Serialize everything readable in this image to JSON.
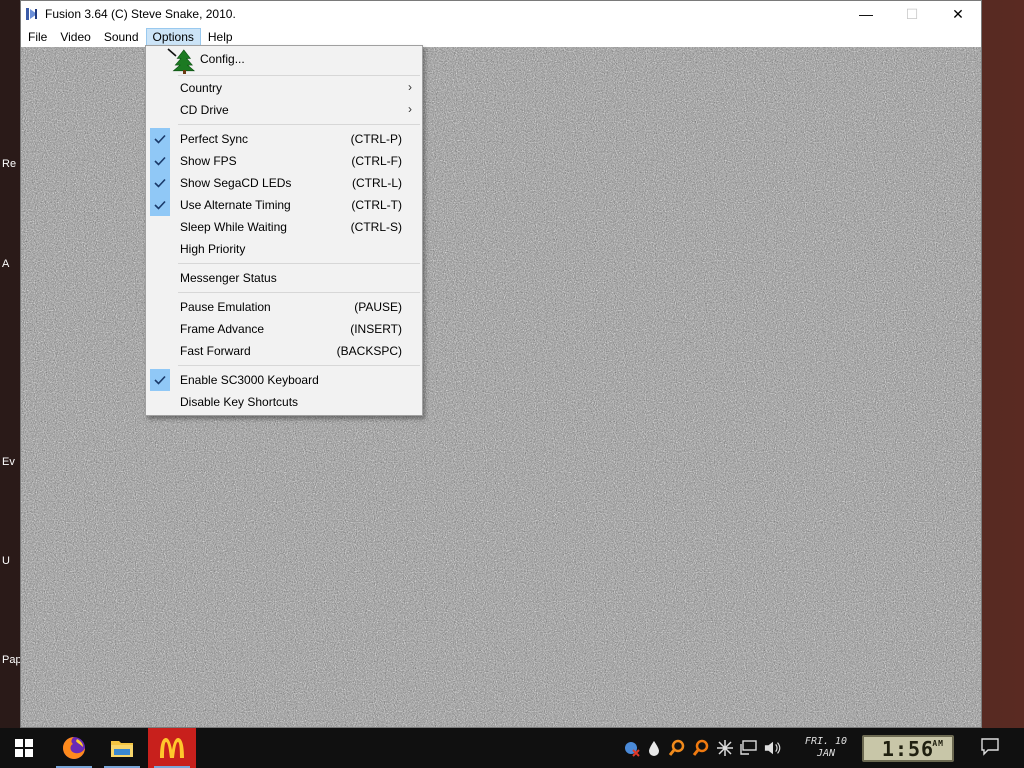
{
  "window": {
    "title": "Fusion 3.64 (C) Steve Snake, 2010.",
    "minimize_glyph": "—",
    "maximize_glyph": "☐",
    "close_glyph": "✕"
  },
  "menubar": [
    "File",
    "Video",
    "Sound",
    "Options",
    "Help"
  ],
  "options_menu": {
    "config": "Config...",
    "country": "Country",
    "cd_drive": "CD Drive",
    "perfect_sync": "Perfect Sync",
    "perfect_sync_shortcut": "(CTRL-P)",
    "show_fps": "Show FPS",
    "show_fps_shortcut": "(CTRL-F)",
    "show_segacd_leds": "Show SegaCD LEDs",
    "show_segacd_leds_shortcut": "(CTRL-L)",
    "use_alternate_timing": "Use Alternate Timing",
    "use_alternate_timing_shortcut": "(CTRL-T)",
    "sleep_while_waiting": "Sleep While Waiting",
    "sleep_while_waiting_shortcut": "(CTRL-S)",
    "high_priority": "High Priority",
    "messenger_status": "Messenger Status",
    "pause_emulation": "Pause Emulation",
    "pause_emulation_shortcut": "(PAUSE)",
    "frame_advance": "Frame Advance",
    "frame_advance_shortcut": "(INSERT)",
    "fast_forward": "Fast Forward",
    "fast_forward_shortcut": "(BACKSPC)",
    "enable_sc3000_keyboard": "Enable SC3000 Keyboard",
    "disable_key_shortcuts": "Disable Key Shortcuts",
    "checked": {
      "perfect_sync": true,
      "show_fps": true,
      "show_segacd_leds": true,
      "use_alternate_timing": true,
      "sleep_while_waiting": false,
      "high_priority": false,
      "enable_sc3000_keyboard": true,
      "disable_key_shortcuts": false
    },
    "submenu_arrow": "›"
  },
  "desktop_fragments": [
    "Re",
    "A",
    "Ev",
    "U",
    "Pap"
  ],
  "taskbar": {
    "pinned": [
      "windows-start",
      "firefox",
      "file-explorer",
      "mcdonalds"
    ],
    "date_line1": "FRI. 10",
    "date_line2": "JAN",
    "clock": "1:56",
    "clock_ampm": "AM"
  },
  "colors": {
    "check_highlight": "#90c8f6",
    "menu_active": "#cce4f7",
    "clock_face": "#c8c6a8"
  }
}
